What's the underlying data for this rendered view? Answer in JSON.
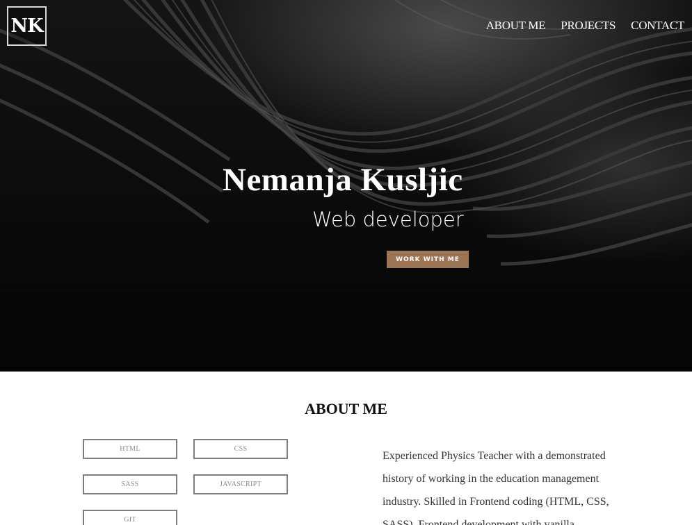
{
  "header": {
    "logo": "NK",
    "nav": [
      "ABOUT ME",
      "PROJECTS",
      "CONTACT"
    ]
  },
  "hero": {
    "name": "Nemanja Kusljic",
    "role": "Web developer",
    "cta": "WORK WITH ME",
    "cta_color": "#9c7554"
  },
  "about": {
    "title": "ABOUT ME",
    "skills": [
      "HTML",
      "CSS",
      "SASS",
      "JAVASCRIPT",
      "GIT"
    ],
    "text": "Experienced Physics Teacher with a demonstrated history of working in the education management industry. Skilled in Frontend coding (HTML, CSS, SASS). Frontend development with vanilla"
  }
}
